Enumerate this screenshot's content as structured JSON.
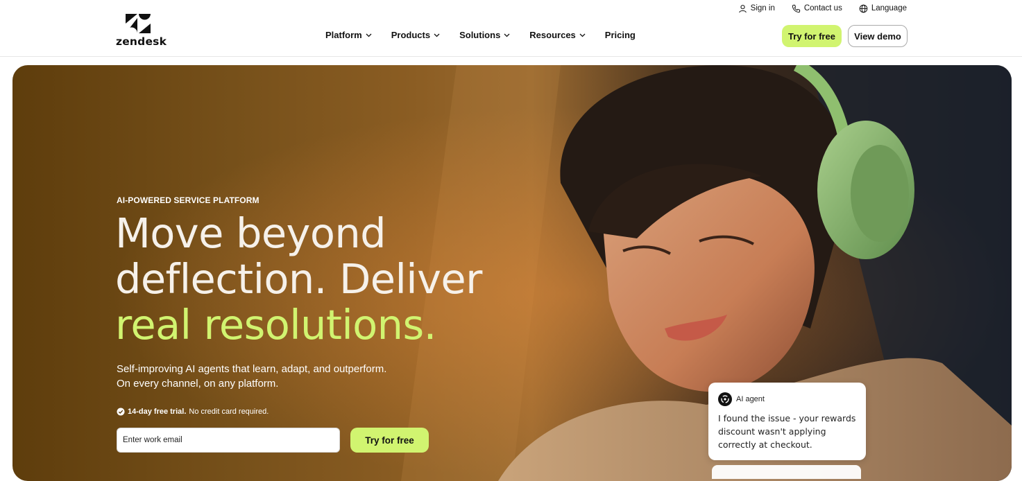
{
  "brand": {
    "name": "zendesk"
  },
  "utility": {
    "sign_in": "Sign in",
    "contact_us": "Contact us",
    "language": "Language"
  },
  "nav": {
    "items": [
      {
        "label": "Platform",
        "has_dropdown": true
      },
      {
        "label": "Products",
        "has_dropdown": true
      },
      {
        "label": "Solutions",
        "has_dropdown": true
      },
      {
        "label": "Resources",
        "has_dropdown": true
      },
      {
        "label": "Pricing",
        "has_dropdown": false
      }
    ],
    "try_free": "Try for free",
    "view_demo": "View demo"
  },
  "hero": {
    "eyebrow": "AI-POWERED SERVICE PLATFORM",
    "headline_line1": "Move beyond",
    "headline_line2": "deflection. Deliver",
    "headline_accent": "real resolutions.",
    "sub_line1": "Self-improving AI agents that learn, adapt, and outperform.",
    "sub_line2": "On every channel, on any platform.",
    "trial_bold": "14-day free trial.",
    "trial_rest": "No credit card required.",
    "email_placeholder": "Enter work email",
    "cta": "Try for free"
  },
  "chat": {
    "sender": "AI agent",
    "message": "I found the issue - your rewards discount wasn't applying correctly at checkout."
  },
  "colors": {
    "accent": "#d1f470",
    "text": "#111111",
    "hero_dark": "#1d1a1d",
    "hero_warm": "#8b5d23"
  }
}
